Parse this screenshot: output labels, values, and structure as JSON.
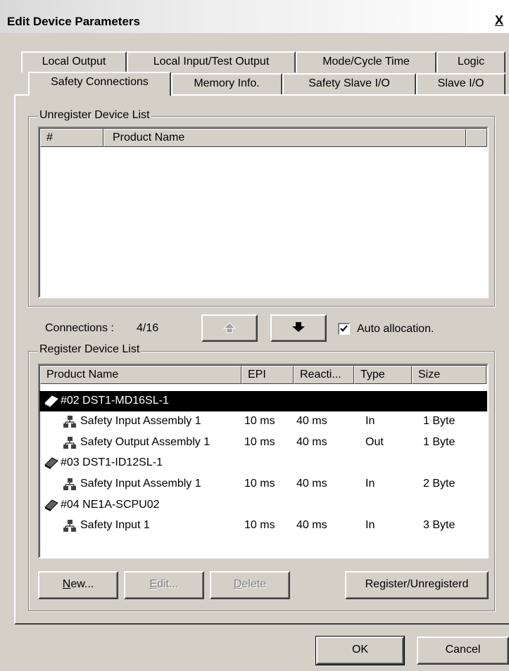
{
  "window": {
    "title": "Edit Device Parameters",
    "close_glyph": "X"
  },
  "tabs_row1": [
    "Local Output",
    "Local Input/Test Output",
    "Mode/Cycle Time",
    "Logic"
  ],
  "tabs_row2": [
    "Safety Connections",
    "Memory Info.",
    "Safety Slave I/O",
    "Slave I/O"
  ],
  "unregister": {
    "title": "Unregister Device List",
    "columns": [
      "#",
      "Product Name",
      ""
    ]
  },
  "connections": {
    "label": "Connections :",
    "value": "4/16",
    "auto_allocation_label": "Auto allocation.",
    "auto_allocation_checked": true
  },
  "register": {
    "title": "Register Device List",
    "columns": [
      "Product Name",
      "EPI",
      "Reacti...",
      "Type",
      "Size"
    ],
    "rows": [
      {
        "kind": "device",
        "name": "#02 DST1-MD16SL-1",
        "selected": true
      },
      {
        "kind": "assembly",
        "name": "Safety Input Assembly 1",
        "epi": "10 ms",
        "react": "40 ms",
        "type": "In",
        "size": "1 Byte"
      },
      {
        "kind": "assembly",
        "name": "Safety Output Assembly 1",
        "epi": "10 ms",
        "react": "40 ms",
        "type": "Out",
        "size": "1 Byte"
      },
      {
        "kind": "device",
        "name": "#03 DST1-ID12SL-1"
      },
      {
        "kind": "assembly",
        "name": "Safety Input Assembly 1",
        "epi": "10 ms",
        "react": "40 ms",
        "type": "In",
        "size": "2 Byte"
      },
      {
        "kind": "device",
        "name": "#04 NE1A-SCPU02"
      },
      {
        "kind": "assembly",
        "name": "Safety Input 1",
        "epi": "10 ms",
        "react": "40 ms",
        "type": "In",
        "size": "3 Byte"
      }
    ]
  },
  "buttons": {
    "new": "New...",
    "edit": "Edit...",
    "delete": "Delete",
    "register_unregister": "Register/Unregisterd",
    "ok": "OK",
    "cancel": "Cancel"
  },
  "icons": {
    "device": "device-icon",
    "assembly": "network-assembly-icon",
    "move_up": "move-up-arrow-icon",
    "move_down": "move-down-arrow-icon"
  }
}
